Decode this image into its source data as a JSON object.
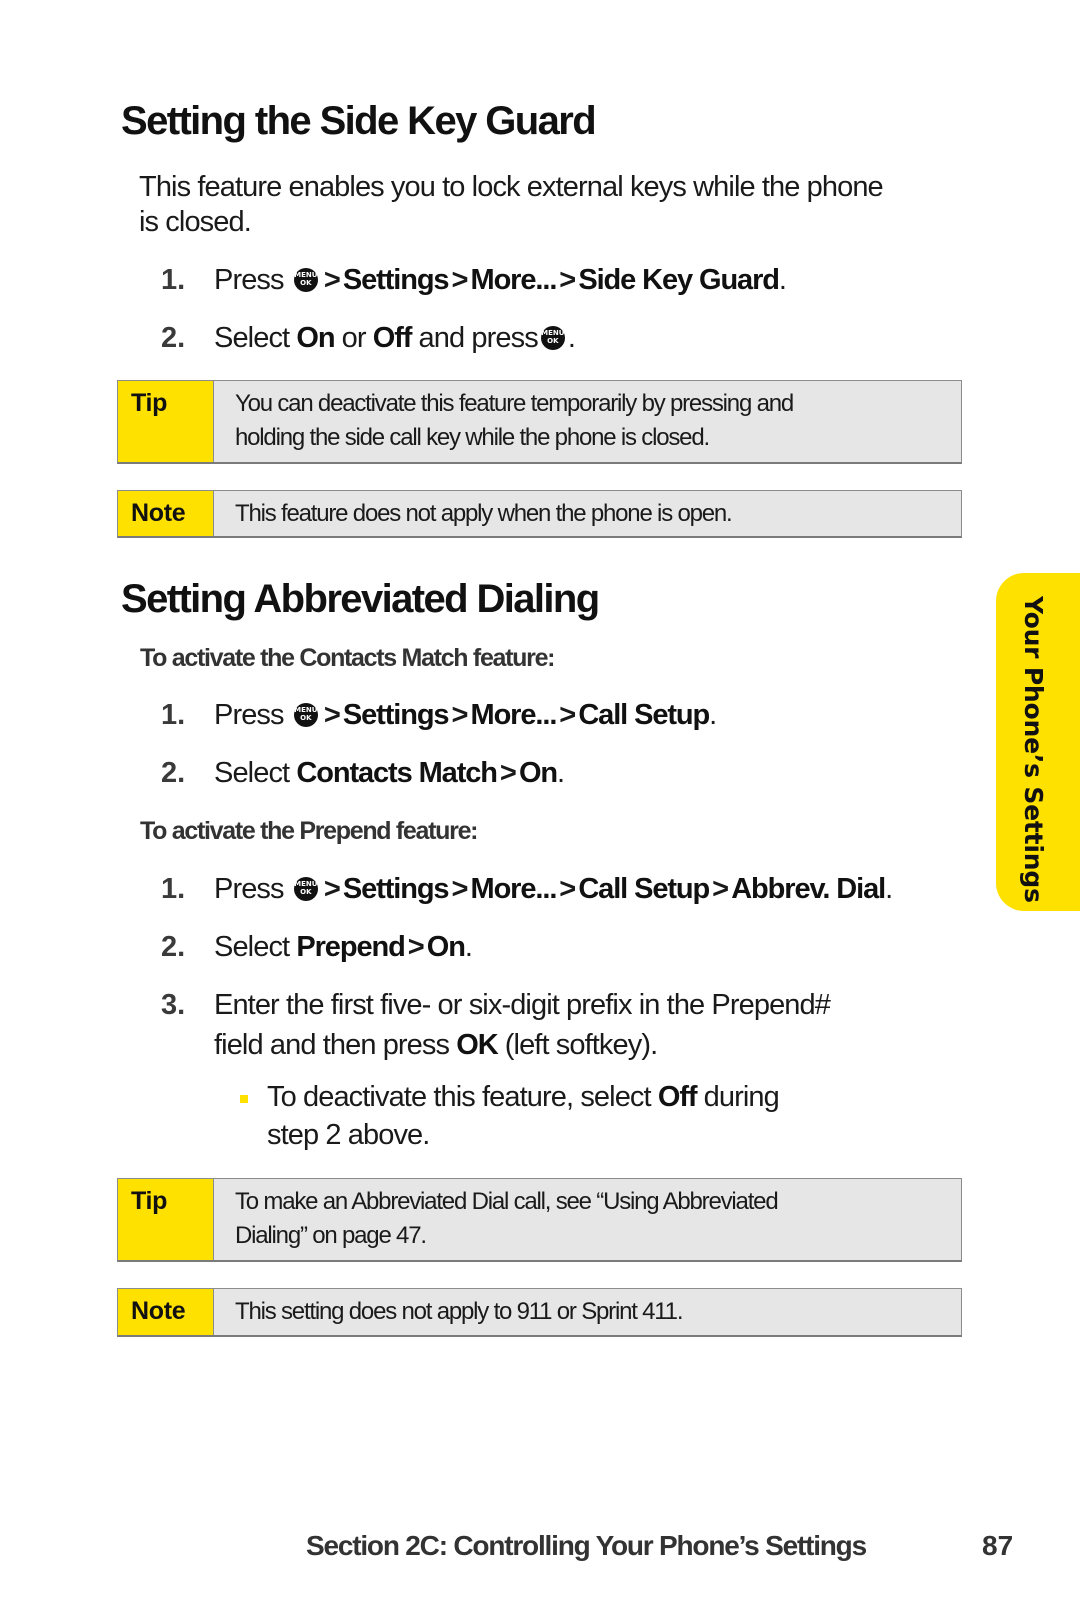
{
  "section1": {
    "title": "Setting the Side Key Guard",
    "intro_line1": "This feature enables you to lock external keys while the phone",
    "intro_line2": "is closed.",
    "steps": [
      {
        "num": "1.",
        "prefix": "Press",
        "icon": "menu-ok-key",
        "path": [
          "Settings",
          "More...",
          "Side Key Guard"
        ],
        "end": "."
      },
      {
        "num": "2.",
        "prefix": "Select",
        "opt1": "On",
        "or": "or",
        "opt2": "Off",
        "mid": "and press",
        "icon": "menu-ok-key",
        "end": "."
      }
    ],
    "tip": {
      "label": "Tip",
      "line1": "You can deactivate this feature temporarily by pressing and",
      "line2": "holding the side call key while the phone is closed."
    },
    "note": {
      "label": "Note",
      "text": "This feature does not apply when the phone is open."
    }
  },
  "section2": {
    "title": "Setting Abbreviated Dialing",
    "sub1": "To activate the Contacts Match feature:",
    "sub1_steps": [
      {
        "num": "1.",
        "prefix": "Press",
        "icon": "menu-ok-key",
        "path": [
          "Settings",
          "More...",
          "Call Setup"
        ],
        "end": "."
      },
      {
        "num": "2.",
        "prefix": "Select",
        "path": [
          "Contacts Match",
          "On"
        ],
        "end": "."
      }
    ],
    "sub2": "To activate the Prepend feature:",
    "sub2_steps": [
      {
        "num": "1.",
        "prefix": "Press",
        "icon": "menu-ok-key",
        "path": [
          "Settings",
          "More...",
          "Call Setup",
          "Abbrev. Dial"
        ],
        "end": "."
      },
      {
        "num": "2.",
        "prefix": "Select",
        "path": [
          "Prepend",
          "On"
        ],
        "end": "."
      },
      {
        "num": "3.",
        "line1": "Enter the first five- or six-digit prefix in the Prepend#",
        "line2_pre": "field and then press",
        "line2_bold": "OK",
        "line2_post": "(left softkey)."
      }
    ],
    "bullet": {
      "pre": "To deactivate this feature, select",
      "bold": "Off",
      "post": "during",
      "line2": "step 2 above."
    },
    "tip": {
      "label": "Tip",
      "line1": "To make an Abbreviated Dial call, see “Using Abbreviated",
      "line2": "Dialing” on page 47."
    },
    "note": {
      "label": "Note",
      "text": "This setting does not apply to 911 or Sprint 411."
    }
  },
  "menu_key": {
    "top": "MENU",
    "bottom": "OK"
  },
  "separator": ">",
  "side_tab": "Your Phone’s Settings",
  "footer": {
    "section": "Section 2C: Controlling Your Phone’s Settings",
    "page": "87"
  },
  "colors": {
    "accent_yellow": "#ffe100",
    "callout_bg": "#e6e6e6",
    "text": "#111111",
    "subtext": "#333333"
  }
}
